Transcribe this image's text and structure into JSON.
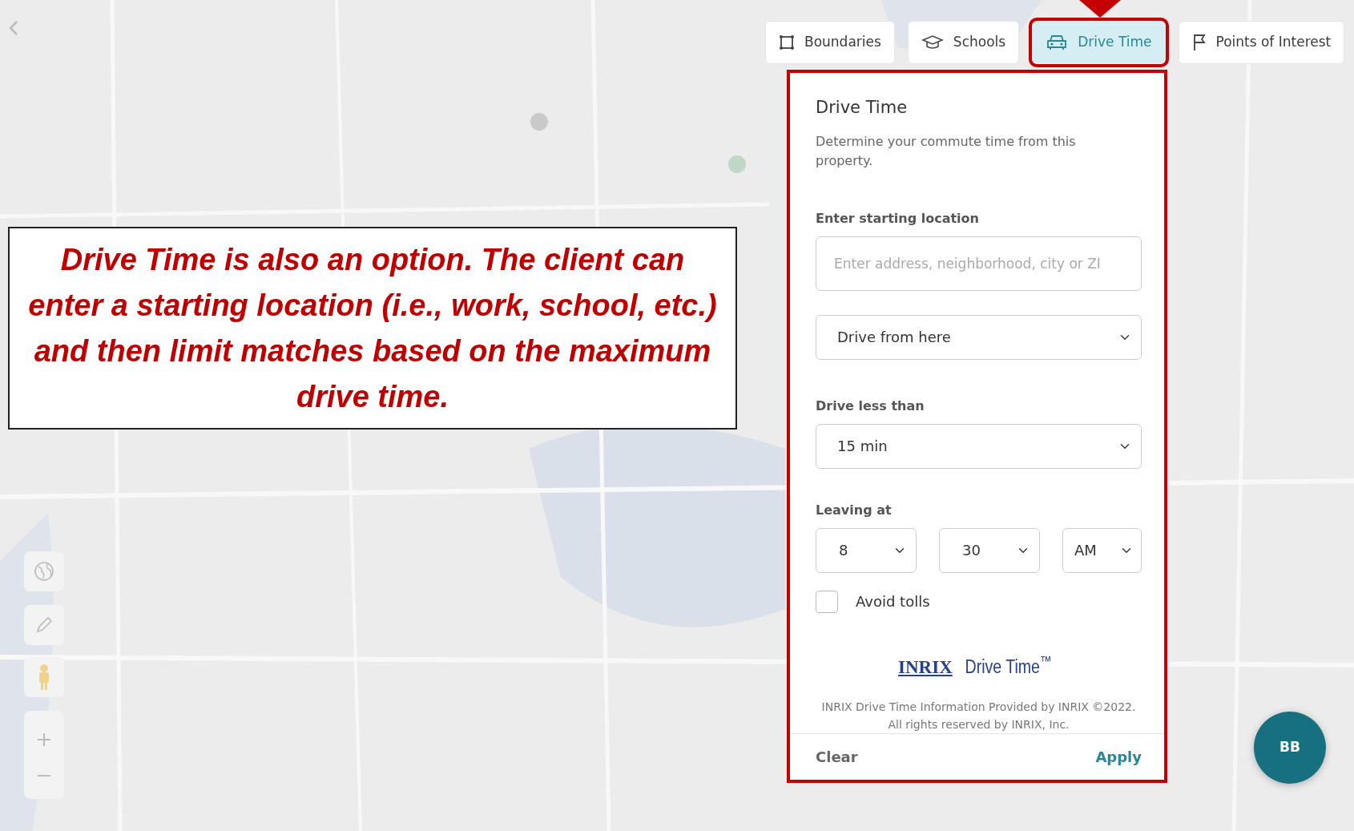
{
  "filters": [
    {
      "label": "Boundaries",
      "kind": "boundary",
      "selected": false
    },
    {
      "label": "Schools",
      "kind": "school",
      "selected": false
    },
    {
      "label": "Drive Time",
      "kind": "car",
      "selected": true
    },
    {
      "label": "Points of Interest",
      "kind": "flag",
      "selected": false
    }
  ],
  "panel": {
    "title": "Drive Time",
    "description": "Determine your commute time from this property.",
    "location_label": "Enter starting location",
    "location_placeholder": "Enter address, neighborhood, city or ZI",
    "direction": "Drive from here",
    "drive_label": "Drive less than",
    "drive_value": "15 min",
    "leaving_label": "Leaving at",
    "hour": "8",
    "minute": "30",
    "meridiem": "AM",
    "avoid_tolls": {
      "label": "Avoid tolls",
      "checked": false
    },
    "logo": {
      "brand": "INRIX",
      "product": "Drive Time",
      "mark": "™"
    },
    "credit_lines": [
      "INRIX Drive Time Information Provided by INRIX ©2022.",
      "All rights reserved by INRIX, Inc."
    ],
    "clear": "Clear",
    "apply": "Apply"
  },
  "annotation": "Drive Time is also an option. The client can enter a starting location (i.e., work, school, etc.) and then limit matches based on the maximum drive time.",
  "avatar": "BB"
}
